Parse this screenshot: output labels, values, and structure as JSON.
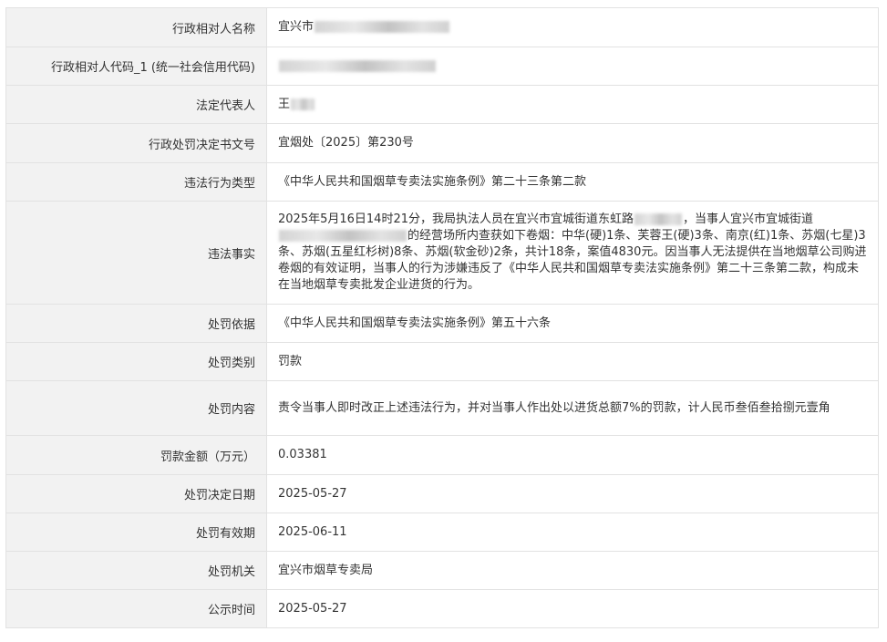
{
  "rows": [
    {
      "label": "行政相对人名称",
      "value_prefix": "宜兴市",
      "redacted": true
    },
    {
      "label": "行政相对人代码_1 (统一社会信用代码)",
      "value_prefix": "",
      "redacted": true
    },
    {
      "label": "法定代表人",
      "value_prefix": "王",
      "redacted": true
    },
    {
      "label": "行政处罚决定书文号",
      "value": "宜烟处〔2025〕第230号"
    },
    {
      "label": "违法行为类型",
      "value": "《中华人民共和国烟草专卖法实施条例》第二十三条第二款"
    },
    {
      "label": "违法事实",
      "value_part1": "2025年5月16日14时21分，我局执法人员在宜兴市宜城街道东虹路",
      "value_part2": "，当事人宜兴市宜城街道",
      "value_part3": "的经营场所内查获如下卷烟：中华(硬)1条、芙蓉王(硬)3条、南京(红)1条、苏烟(七星)3条、苏烟(五星红杉树)8条、苏烟(软金砂)2条，共计18条，案值4830元。因当事人无法提供在当地烟草公司购进卷烟的有效证明，当事人的行为涉嫌违反了《中华人民共和国烟草专卖法实施条例》第二十三条第二款，构成未在当地烟草专卖批发企业进货的行为。"
    },
    {
      "label": "处罚依据",
      "value": "《中华人民共和国烟草专卖法实施条例》第五十六条"
    },
    {
      "label": "处罚类别",
      "value": "罚款"
    },
    {
      "label": "处罚内容",
      "value": "责令当事人即时改正上述违法行为，并对当事人作出处以进货总额7%的罚款，计人民币叁佰叁拾捌元壹角"
    },
    {
      "label": "罚款金额（万元）",
      "value": "0.03381"
    },
    {
      "label": "处罚决定日期",
      "value": "2025-05-27"
    },
    {
      "label": "处罚有效期",
      "value": "2025-06-11"
    },
    {
      "label": "处罚机关",
      "value": "宜兴市烟草专卖局"
    },
    {
      "label": "公示时间",
      "value": "2025-05-27"
    }
  ]
}
